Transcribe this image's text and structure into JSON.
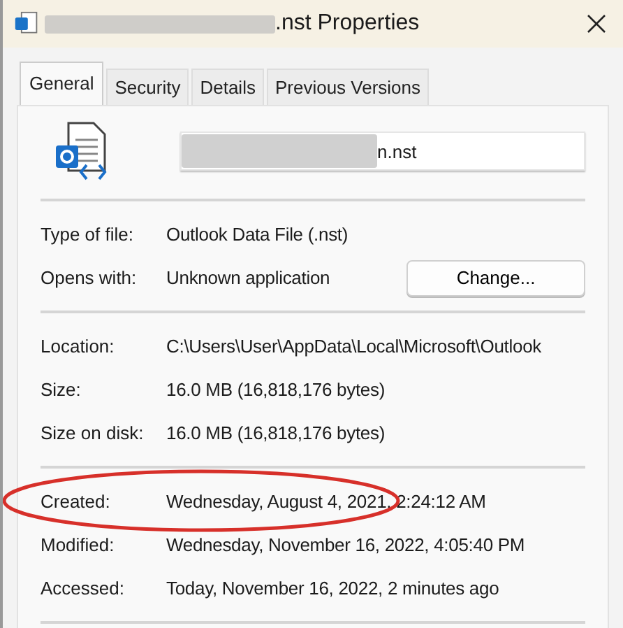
{
  "window": {
    "title": ".nst Properties",
    "title_redacted": true
  },
  "tabs": [
    {
      "label": "General",
      "selected": true
    },
    {
      "label": "Security",
      "selected": false
    },
    {
      "label": "Details",
      "selected": false
    },
    {
      "label": "Previous Versions",
      "selected": false
    }
  ],
  "file_name": {
    "value": "n.nst",
    "redacted": true
  },
  "sections": [
    {
      "rows": [
        {
          "label": "Type of file:",
          "value": "Outlook Data File (.nst)",
          "circled": false
        },
        {
          "label": "Opens with:",
          "value": "Unknown application",
          "button": "Change...",
          "circled": false
        }
      ]
    },
    {
      "rows": [
        {
          "label": "Location:",
          "value": "C:\\Users\\User\\AppData\\Local\\Microsoft\\Outlook",
          "circled": false
        },
        {
          "label": "Size:",
          "value": "16.0 MB (16,818,176 bytes)",
          "circled": false
        },
        {
          "label": "Size on disk:",
          "value": "16.0 MB (16,818,176 bytes)",
          "circled": false
        }
      ]
    },
    {
      "rows": [
        {
          "label": "Created:",
          "value": "Wednesday, August 4, 2021, 2:24:12 AM",
          "circled": true
        },
        {
          "label": "Modified:",
          "value": "Wednesday, November 16, 2022, 4:05:40 PM",
          "circled": false
        },
        {
          "label": "Accessed:",
          "value": "Today, November 16, 2022, 2 minutes ago",
          "circled": false
        }
      ]
    }
  ]
}
